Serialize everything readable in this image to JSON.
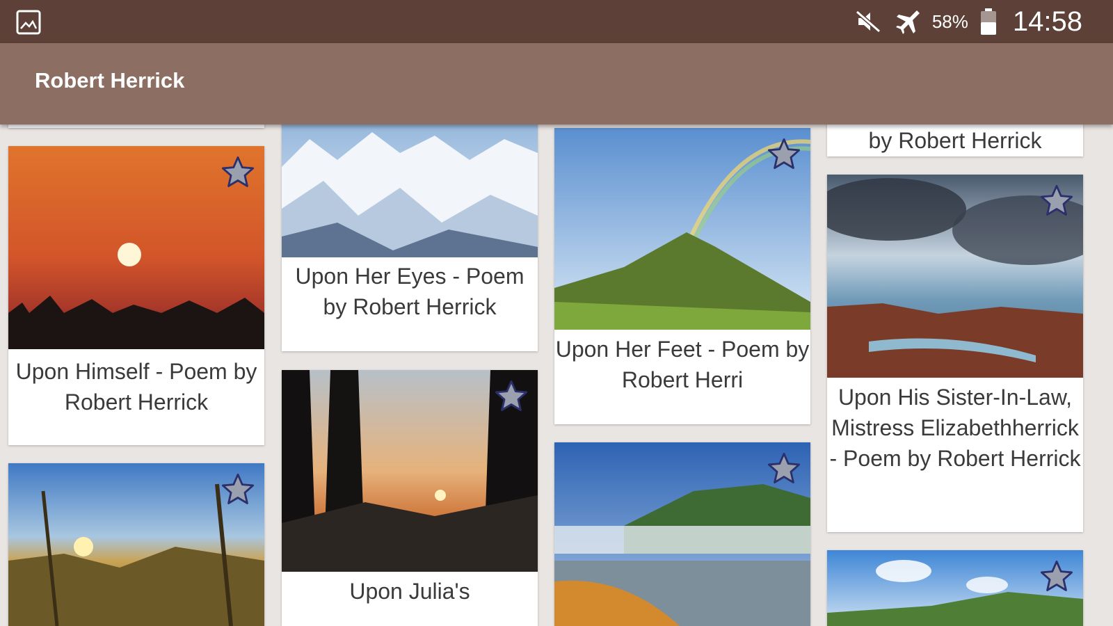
{
  "status_bar": {
    "battery_text": "58%",
    "time": "14:58",
    "icons": [
      "gallery-icon",
      "mute-icon",
      "airplane-icon",
      "battery-icon"
    ]
  },
  "app_bar": {
    "title": "Robert Herrick"
  },
  "cards": [
    {
      "caption": "Upon Himself - Poem by Robert Herrick",
      "image": "orange sunset over grass"
    },
    {
      "caption": "",
      "image": "sunlit forest valley"
    },
    {
      "caption": "Upon Her Eyes - Poem by Robert Herrick",
      "image": "snowy mountain range"
    },
    {
      "caption": "Upon Julia's",
      "image": "sunset through pine trees"
    },
    {
      "caption": "Upon Her Feet - Poem by Robert Herri",
      "image": "green hill with rainbow"
    },
    {
      "caption": "",
      "image": "misty hot spring landscape"
    },
    {
      "caption": "by Robert Herrick",
      "image": ""
    },
    {
      "caption": "Upon His Sister-In-Law, Mistress Elizabethherrick - Poem by Robert Herrick",
      "image": "stormy clouds over rocky shore"
    },
    {
      "caption": "",
      "image": "blue sky over green hills"
    }
  ],
  "colors": {
    "status_bar": "#5d4037",
    "app_bar": "#8d6e63",
    "background": "#e9e5e3",
    "star": "#9aa0ae"
  }
}
